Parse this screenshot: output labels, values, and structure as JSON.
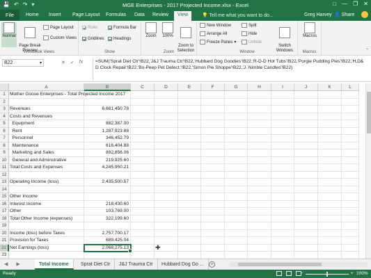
{
  "window": {
    "title": "MGE Enterprises - 2017 Projected Income.xlsx - Excel",
    "qat_icons": [
      "save-icon",
      "undo-icon",
      "redo-icon",
      "customize-qat-icon"
    ],
    "controls": [
      "ribbon-display-icon",
      "minimize-icon",
      "restore-icon",
      "close-icon"
    ]
  },
  "tabs": {
    "file": "File",
    "items": [
      "Home",
      "Insert",
      "Page Layout",
      "Formulas",
      "Data",
      "Review",
      "View"
    ],
    "active": "View",
    "tell_me": "Tell me what you want to do...",
    "user": "Greg Harvey",
    "share": "Share"
  },
  "ribbon": {
    "workbook_views": {
      "label": "Workbook Views",
      "normal": "Normal",
      "page_break": "Page Break\nPreview",
      "page_layout": "Page Layout",
      "custom_views": "Custom Views"
    },
    "show": {
      "label": "Show",
      "ruler": "Ruler",
      "formula_bar": "Formula Bar",
      "gridlines": "Gridlines",
      "headings": "Headings"
    },
    "zoom": {
      "label": "Zoom",
      "zoom": "Zoom",
      "hundred": "100%",
      "to_selection": "Zoom to\nSelection"
    },
    "window": {
      "label": "Window",
      "new_window": "New Window",
      "arrange_all": "Arrange All",
      "freeze_panes": "Freeze Panes",
      "split": "Split",
      "hide": "Hide",
      "unhide": "Unhide",
      "switch_windows": "Switch\nWindows"
    },
    "macros": {
      "label": "Macros",
      "macros": "Macros"
    }
  },
  "formula_bar": {
    "name_box": "B22",
    "formula": "=SUM('Sprat Diet Ctr'!B22,'J&J Trauma Ctr'!B22,'Hubbard Dog Goodies'!B22,'R-D-D Hot Tubs'!B22,'Porgie Pudding Pies'!B22,'H,D&D Clock Repair'!B22,'Bo-Peep Pet Detect.'!B22,'Simon Pie Shoppe'!B22,'J. Nimble Candles'!B22)"
  },
  "grid": {
    "columns": [
      "A",
      "B",
      "C",
      "D",
      "E",
      "F",
      "G",
      "H",
      "I",
      "J",
      "K",
      "L"
    ],
    "selected_column": "B",
    "selected_row": "22",
    "rows": [
      {
        "n": "1",
        "a": "Mother Goose Enterprises - Total Projected Income 2017",
        "b": ""
      },
      {
        "n": "2",
        "a": "",
        "b": ""
      },
      {
        "n": "3",
        "a": "Revenues",
        "b": "6,681,450.78"
      },
      {
        "n": "4",
        "a": "Costs and Revenues",
        "b": ""
      },
      {
        "n": "5",
        "a": "  Equipment",
        "b": "882,387.00"
      },
      {
        "n": "6",
        "a": "  Rent",
        "b": "1,287,923.88"
      },
      {
        "n": "7",
        "a": "  Personnel",
        "b": "346,452.79"
      },
      {
        "n": "8",
        "a": "  Maintenance",
        "b": "616,404.88"
      },
      {
        "n": "9",
        "a": "  Marketing and Sales",
        "b": "892,856.06"
      },
      {
        "n": "10",
        "a": "  General and Adminstrative",
        "b": "219,925.60"
      },
      {
        "n": "11",
        "a": "Total Costs and Expenses",
        "b": "4,245,950.21"
      },
      {
        "n": "12",
        "a": "",
        "b": ""
      },
      {
        "n": "13",
        "a": "Operating Income (loss)",
        "b": "2,435,500.57"
      },
      {
        "n": "14",
        "a": "",
        "b": ""
      },
      {
        "n": "15",
        "a": "Other Income",
        "b": ""
      },
      {
        "n": "16",
        "a": "Interest Income",
        "b": "218,430.60"
      },
      {
        "n": "17",
        "a": "Other",
        "b": "103,769.00"
      },
      {
        "n": "18",
        "a": "Total Other Income (expenses)",
        "b": "322,199.60"
      },
      {
        "n": "19",
        "a": "",
        "b": ""
      },
      {
        "n": "20",
        "a": "Income (loss) before Taxes",
        "b": "2,757,700.17"
      },
      {
        "n": "21",
        "a": "Provision for Taxes",
        "b": "689,425.04"
      },
      {
        "n": "22",
        "a": "Net Earnings (loss)",
        "b": "2,068,275.13"
      },
      {
        "n": "23",
        "a": "",
        "b": ""
      }
    ]
  },
  "sheets": {
    "tabs": [
      "Total Income",
      "Sprat Diet Ctr",
      "J&J Trauma Ctr",
      "Hubbard Dog Go ..."
    ],
    "active": "Total Income"
  },
  "status": {
    "ready": "Ready",
    "zoom": "100%"
  },
  "colors": {
    "brand": "#217346",
    "selection_fill": "#c6dfcf"
  }
}
